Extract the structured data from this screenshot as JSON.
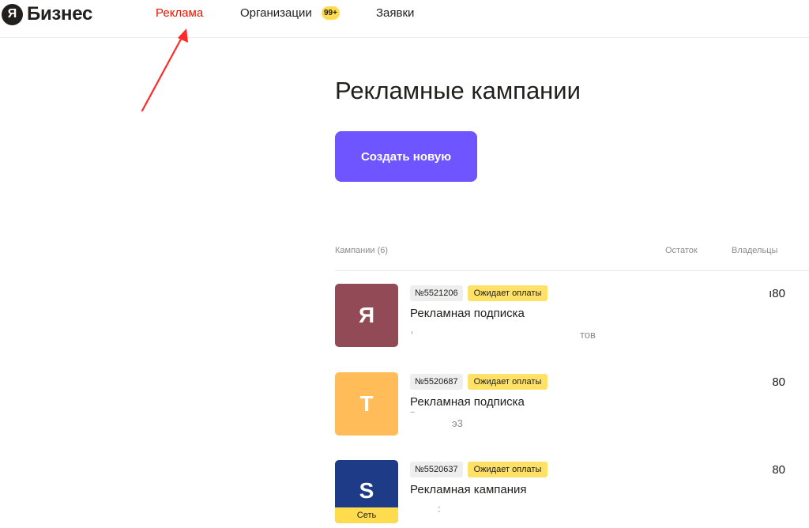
{
  "header": {
    "logo_mark": "Я",
    "logo_text": "Бизнес",
    "nav": [
      {
        "label": "Реклама",
        "active": true
      },
      {
        "label": "Организации",
        "badge": "99+"
      },
      {
        "label": "Заявки"
      }
    ]
  },
  "main": {
    "title": "Рекламные кампании",
    "create_label": "Создать новую",
    "table": {
      "columns": [
        "Кампании (6)",
        "Остаток",
        "Владельцы"
      ],
      "rows": [
        {
          "letter": "Я",
          "color": "#924a57",
          "id": "№5521206",
          "status": "Ожидает оплаты",
          "title": "Рекламная подписка",
          "subtitle_a": "‘",
          "subtitle_b": "тов",
          "value": "ı80",
          "tag": ""
        },
        {
          "letter": "T",
          "color": "#ffbc58",
          "id": "№5520687",
          "status": "Ожидает оплаты",
          "title": "Рекламная подписка",
          "subtitle_a": "‾",
          "subtitle_b": "э3",
          "value": "80",
          "tag": ""
        },
        {
          "letter": "S",
          "color": "#1e3b87",
          "id": "№5520637",
          "status": "Ожидает оплаты",
          "title": "Рекламная кампания",
          "subtitle_a": "",
          "subtitle_b": ":",
          "value": "80",
          "tag": "Сеть"
        }
      ]
    }
  },
  "colors": {
    "accent": "#6e55ff",
    "active_nav": "#e61400",
    "status_badge": "#ffe166",
    "annotation_arrow": "#ff2a2a"
  }
}
